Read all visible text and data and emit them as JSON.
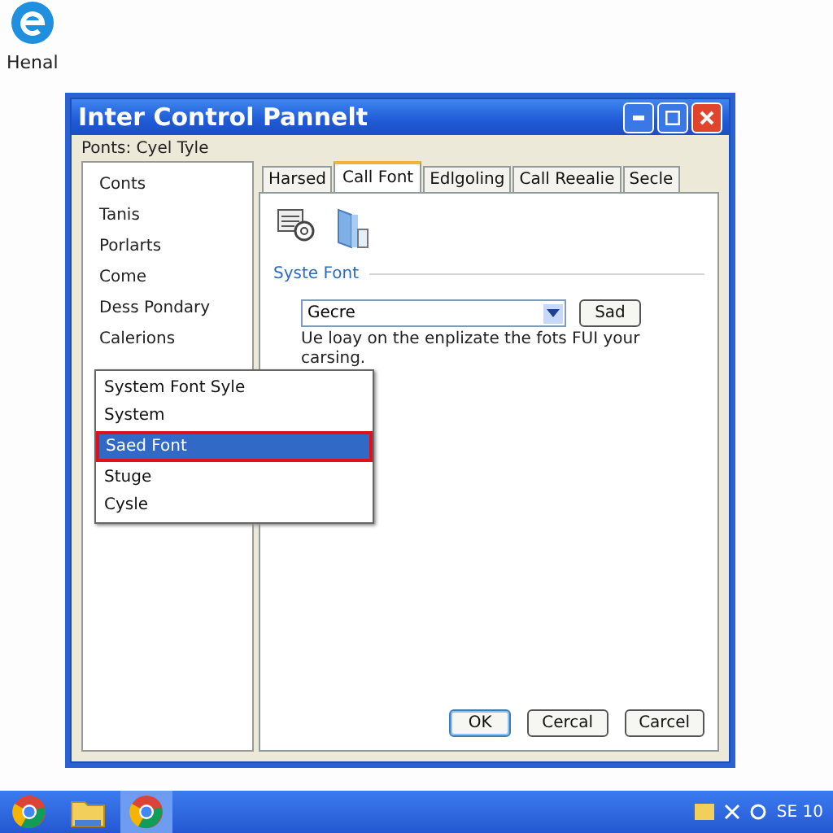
{
  "desktop_icons": [
    {
      "label": "Henal"
    }
  ],
  "window": {
    "title": "Inter Control Pannelt",
    "subtitle": "Ponts: Cyel Tyle"
  },
  "sidebar": {
    "items": [
      {
        "label": "Conts"
      },
      {
        "label": "Tanis"
      },
      {
        "label": "Porlarts"
      },
      {
        "label": "Come"
      },
      {
        "label": "Dess Pondary"
      },
      {
        "label": "Calerions"
      }
    ]
  },
  "popup": {
    "items": [
      {
        "label": "System Font Syle",
        "selected": false
      },
      {
        "label": "System",
        "selected": false
      },
      {
        "label": "Saed Font",
        "selected": true
      },
      {
        "label": "Stuge",
        "selected": false
      },
      {
        "label": "Cysle",
        "selected": false
      }
    ]
  },
  "tabs": [
    {
      "label": "Harsed",
      "selected": false
    },
    {
      "label": "Call Font",
      "selected": true
    },
    {
      "label": "Edlgoling",
      "selected": false
    },
    {
      "label": "Call Reealie",
      "selected": false
    },
    {
      "label": "Secle",
      "selected": false
    }
  ],
  "section": {
    "title": "Syste Font"
  },
  "font_field": {
    "value": "Gecre"
  },
  "apply_button": "Sad",
  "description": "Ue loay on the enplizate the fots FUI your carsing.",
  "buttons": [
    {
      "label": "OK",
      "default": true
    },
    {
      "label": "Cercal",
      "default": false
    },
    {
      "label": "Carcel",
      "default": false
    }
  ],
  "taskbar": {
    "apps": [
      {
        "kind": "browser",
        "selected": false
      },
      {
        "kind": "folder",
        "selected": false
      },
      {
        "kind": "browser",
        "selected": true
      }
    ],
    "clock": "SE 10"
  }
}
